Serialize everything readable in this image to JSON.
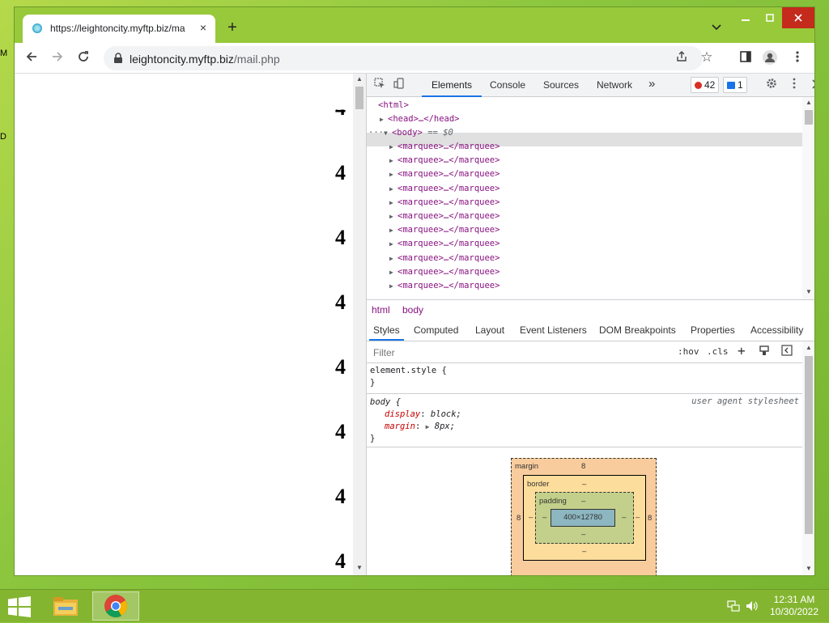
{
  "desktop": {
    "edge_m": "M",
    "edge_d": "D"
  },
  "browser": {
    "tab_title": "https://leightoncity.myftp.biz/ma",
    "tab_close": "×",
    "new_tab": "+",
    "url_host": "leightoncity.myftp.biz",
    "url_path": "/mail.php",
    "page_digits": [
      "4",
      "4",
      "4",
      "4",
      "4",
      "4",
      "4"
    ]
  },
  "devtools": {
    "tabs": [
      "Elements",
      "Console",
      "Sources",
      "Network"
    ],
    "more_tabs": "»",
    "errors": "42",
    "messages": "1",
    "dom": {
      "html": "<html>",
      "head": "<head>…</head>",
      "body": "<body>",
      "body_eq": "== $0",
      "dots": "···",
      "marquee": "<marquee>…</marquee>",
      "marquee_count": 11
    },
    "breadcrumbs": [
      "html",
      "body"
    ],
    "style_tabs": [
      "Styles",
      "Computed",
      "Layout",
      "Event Listeners",
      "DOM Breakpoints",
      "Properties",
      "Accessibility"
    ],
    "filter_placeholder": "Filter",
    "hov": ":hov",
    "cls": ".cls",
    "element_style_open": "element.style {",
    "close_brace": "}",
    "body_rule_open": "body {",
    "ua_label": "user agent stylesheet",
    "props": [
      {
        "name": "display",
        "value": "block;"
      },
      {
        "name": "margin",
        "value": "8px;"
      }
    ],
    "box_model": {
      "margin_label": "margin",
      "margin_top": "8",
      "margin_left": "8",
      "margin_right": "8",
      "border_label": "border",
      "border_val": "–",
      "padding_label": "padding",
      "padding_val": "–",
      "content": "400×12780"
    }
  },
  "taskbar": {
    "time": "12:31 AM",
    "date": "10/30/2022"
  },
  "colors": {
    "accent": "#1a73e8",
    "error": "#d93025",
    "tag": "#881280",
    "property": "#c80000",
    "close_button": "#c42b1c"
  }
}
